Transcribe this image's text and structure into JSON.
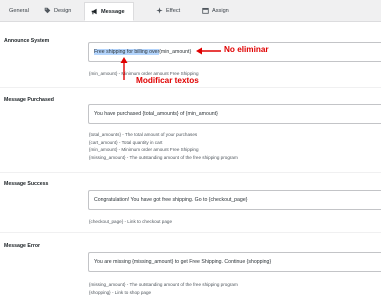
{
  "tabs": [
    {
      "label": "General",
      "icon": "gear-icon"
    },
    {
      "label": "Design",
      "icon": "tag-icon"
    },
    {
      "label": "Message",
      "icon": "megaphone-icon",
      "active": true
    },
    {
      "label": "Effect",
      "icon": "sparkle-icon"
    },
    {
      "label": "Assign",
      "icon": "calendar-icon"
    }
  ],
  "sections": {
    "announce": {
      "label": "Announce System",
      "field_highlight": "Free shipping for billing over",
      "field_rest": " {min_amount}",
      "help": [
        "{min_amount} - Minimum order amount Free Shipping"
      ]
    },
    "purchased": {
      "label": "Message Purchased",
      "field": "You have purchased {total_amounts} of {min_amount}",
      "help": [
        "{total_amounts} - The total amount of your purchases",
        "{cart_amount} - Total quantity in cart",
        "{min_amount} - Minimum order amount Free Shipping",
        "{missing_amount} - The outstanding amount of the free shipping program"
      ]
    },
    "success": {
      "label": "Message Success",
      "field": "Congratulation! You have got free shipping. Go to {checkout_page}",
      "help": [
        "{checkout_page} - Link to checkout page"
      ]
    },
    "error": {
      "label": "Message Error",
      "field": "You are missing {missing_amount} to get Free Shipping. Continue {shopping}",
      "help": [
        "{missing_amount} - The outstanding amount of the free shipping program",
        "{shopping} - Link to shop page"
      ]
    }
  },
  "annotations": {
    "no_eliminar": "No eliminar",
    "modificar": "Modificar textos"
  },
  "colors": {
    "annotation": "#e00000",
    "highlight": "#b3d4fc"
  }
}
